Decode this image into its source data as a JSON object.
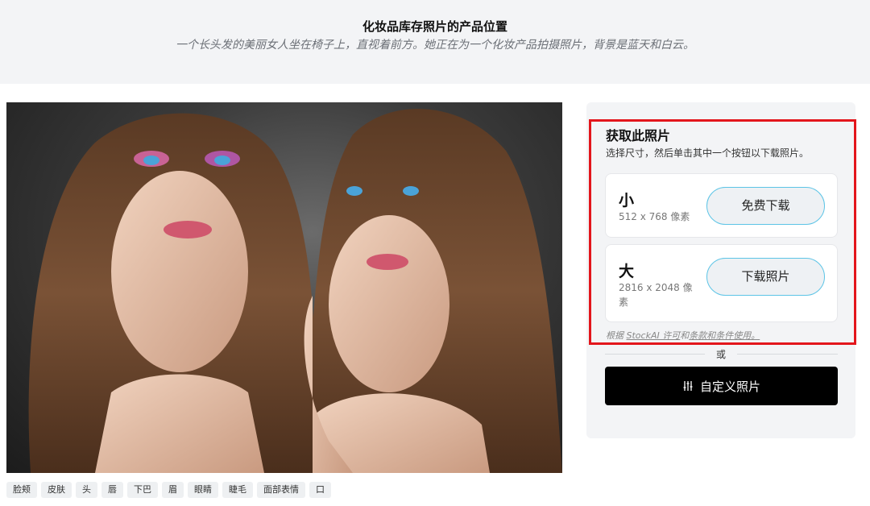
{
  "header": {
    "title": "化妆品库存照片的产品位置",
    "subtitle": "一个长头发的美丽女人坐在椅子上，直视着前方。她正在为一个化妆产品拍摄照片，背景是蓝天和白云。"
  },
  "tags": [
    "脸颊",
    "皮肤",
    "头",
    "唇",
    "下巴",
    "眉",
    "眼睛",
    "睫毛",
    "面部表情",
    "口"
  ],
  "panel": {
    "title": "获取此照片",
    "description": "选择尺寸，然后单击其中一个按钮以下载照片。",
    "sizes": [
      {
        "name": "小",
        "dimensions": "512 x 768 像素",
        "button": "免费下载"
      },
      {
        "name": "大",
        "dimensions": "2816 x 2048 像素",
        "button": "下载照片"
      }
    ],
    "license_prefix": "根据",
    "license_link1": "StockAI 许可",
    "license_mid": "和",
    "license_link2": "条款和条件使用。",
    "or": "或",
    "custom_button": "自定义照片"
  },
  "colors": {
    "highlight_border": "#e3161c",
    "button_border": "#5cc4e6",
    "primary_button": "#000000"
  }
}
